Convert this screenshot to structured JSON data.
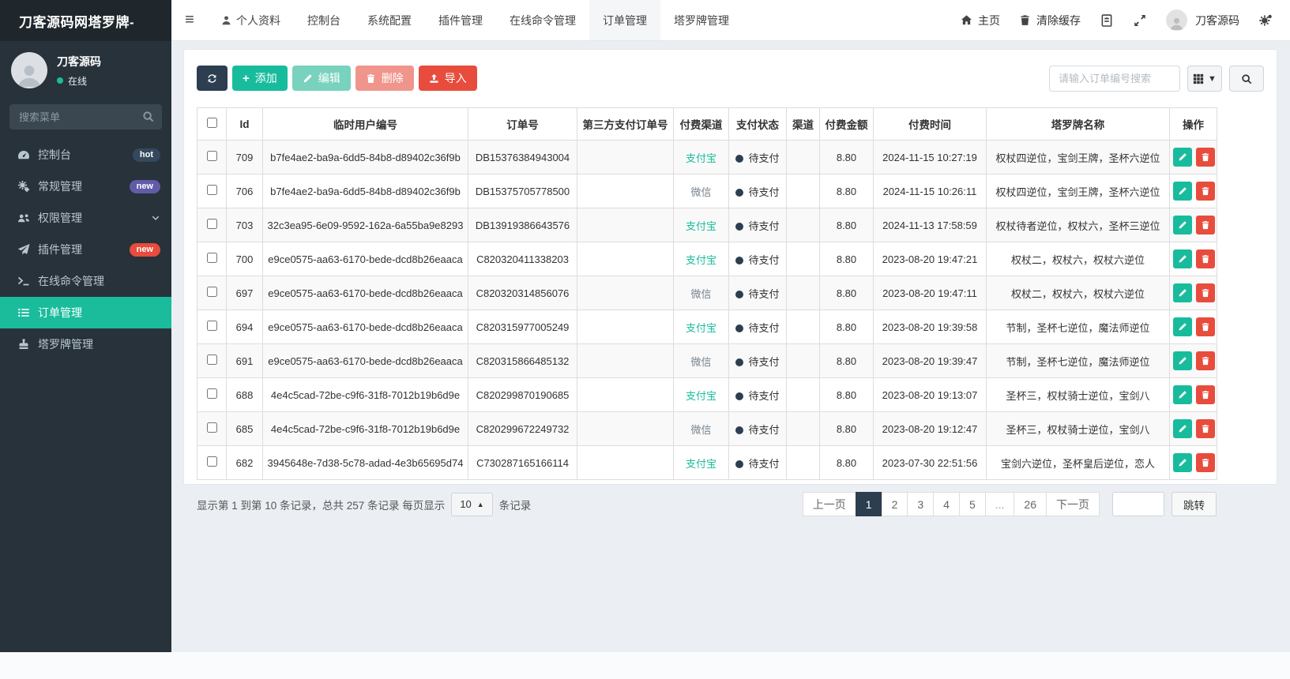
{
  "sidebar": {
    "logo": "刀客源码网塔罗牌-",
    "user": {
      "name": "刀客源码",
      "status": "在线"
    },
    "search_placeholder": "搜索菜单",
    "items": [
      {
        "label": "控制台",
        "icon": "tachometer-icon",
        "badge": {
          "text": "hot",
          "color": "#34495e"
        }
      },
      {
        "label": "常规管理",
        "icon": "gears-icon",
        "badge": {
          "text": "new",
          "color": "#605ca8"
        }
      },
      {
        "label": "权限管理",
        "icon": "users-icon"
      },
      {
        "label": "插件管理",
        "icon": "paper-plane-icon",
        "badge": {
          "text": "new",
          "color": "#e74c3c"
        }
      },
      {
        "label": "在线命令管理",
        "icon": "terminal-icon"
      },
      {
        "label": "订单管理",
        "icon": "list-icon",
        "active": true
      },
      {
        "label": "塔罗牌管理",
        "icon": "stamp-icon"
      }
    ]
  },
  "topnav": {
    "tabs": [
      {
        "label": "个人资料",
        "icon": "user-icon"
      },
      {
        "label": "控制台"
      },
      {
        "label": "系统配置"
      },
      {
        "label": "插件管理"
      },
      {
        "label": "在线命令管理"
      },
      {
        "label": "订单管理",
        "active": true
      },
      {
        "label": "塔罗牌管理"
      }
    ],
    "right": {
      "home": "主页",
      "clear_cache": "清除缓存",
      "username": "刀客源码"
    }
  },
  "toolbar": {
    "add_label": "添加",
    "edit_label": "编辑",
    "delete_label": "删除",
    "import_label": "导入",
    "search_placeholder": "请输入订单编号搜索"
  },
  "table": {
    "columns": [
      "Id",
      "临时用户编号",
      "订单号",
      "第三方支付订单号",
      "付费渠道",
      "支付状态",
      "渠道",
      "付费金额",
      "付费时间",
      "塔罗牌名称",
      "操作"
    ],
    "rows": [
      {
        "id": "709",
        "user_code": "b7fe4ae2-ba9a-6dd5-84b8-d89402c36f9b",
        "order_no": "DB15376384943004",
        "third_no": "",
        "channel": "支付宝",
        "channel_color": "#1abc9c",
        "status": "待支付",
        "qudao": "",
        "amount": "8.80",
        "time": "2024-11-15 10:27:19",
        "tarot": "权杖四逆位，宝剑王牌，圣杯六逆位"
      },
      {
        "id": "706",
        "user_code": "b7fe4ae2-ba9a-6dd5-84b8-d89402c36f9b",
        "order_no": "DB15375705778500",
        "third_no": "",
        "channel": "微信",
        "channel_color": "#76838f",
        "status": "待支付",
        "qudao": "",
        "amount": "8.80",
        "time": "2024-11-15 10:26:11",
        "tarot": "权杖四逆位，宝剑王牌，圣杯六逆位"
      },
      {
        "id": "703",
        "user_code": "32c3ea95-6e09-9592-162a-6a55ba9e8293",
        "order_no": "DB13919386643576",
        "third_no": "",
        "channel": "支付宝",
        "channel_color": "#1abc9c",
        "status": "待支付",
        "qudao": "",
        "amount": "8.80",
        "time": "2024-11-13 17:58:59",
        "tarot": "权杖待者逆位，权杖六，圣杯三逆位"
      },
      {
        "id": "700",
        "user_code": "e9ce0575-aa63-6170-bede-dcd8b26eaaca",
        "order_no": "C820320411338203",
        "third_no": "",
        "channel": "支付宝",
        "channel_color": "#1abc9c",
        "status": "待支付",
        "qudao": "",
        "amount": "8.80",
        "time": "2023-08-20 19:47:21",
        "tarot": "权杖二，权杖六，权杖六逆位"
      },
      {
        "id": "697",
        "user_code": "e9ce0575-aa63-6170-bede-dcd8b26eaaca",
        "order_no": "C820320314856076",
        "third_no": "",
        "channel": "微信",
        "channel_color": "#76838f",
        "status": "待支付",
        "qudao": "",
        "amount": "8.80",
        "time": "2023-08-20 19:47:11",
        "tarot": "权杖二，权杖六，权杖六逆位"
      },
      {
        "id": "694",
        "user_code": "e9ce0575-aa63-6170-bede-dcd8b26eaaca",
        "order_no": "C820315977005249",
        "third_no": "",
        "channel": "支付宝",
        "channel_color": "#1abc9c",
        "status": "待支付",
        "qudao": "",
        "amount": "8.80",
        "time": "2023-08-20 19:39:58",
        "tarot": "节制，圣杯七逆位，魔法师逆位"
      },
      {
        "id": "691",
        "user_code": "e9ce0575-aa63-6170-bede-dcd8b26eaaca",
        "order_no": "C820315866485132",
        "third_no": "",
        "channel": "微信",
        "channel_color": "#76838f",
        "status": "待支付",
        "qudao": "",
        "amount": "8.80",
        "time": "2023-08-20 19:39:47",
        "tarot": "节制，圣杯七逆位，魔法师逆位"
      },
      {
        "id": "688",
        "user_code": "4e4c5cad-72be-c9f6-31f8-7012b19b6d9e",
        "order_no": "C820299870190685",
        "third_no": "",
        "channel": "支付宝",
        "channel_color": "#1abc9c",
        "status": "待支付",
        "qudao": "",
        "amount": "8.80",
        "time": "2023-08-20 19:13:07",
        "tarot": "圣杯三，权杖骑士逆位，宝剑八"
      },
      {
        "id": "685",
        "user_code": "4e4c5cad-72be-c9f6-31f8-7012b19b6d9e",
        "order_no": "C820299672249732",
        "third_no": "",
        "channel": "微信",
        "channel_color": "#76838f",
        "status": "待支付",
        "qudao": "",
        "amount": "8.80",
        "time": "2023-08-20 19:12:47",
        "tarot": "圣杯三，权杖骑士逆位，宝剑八"
      },
      {
        "id": "682",
        "user_code": "3945648e-7d38-5c78-adad-4e3b65695d74",
        "order_no": "C730287165166114",
        "third_no": "",
        "channel": "支付宝",
        "channel_color": "#1abc9c",
        "status": "待支付",
        "qudao": "",
        "amount": "8.80",
        "time": "2023-07-30 22:51:56",
        "tarot": "宝剑六逆位，圣杯皇后逆位，恋人"
      }
    ],
    "status_dot_color": "#2c3e50"
  },
  "footer": {
    "summary_prefix": "显示第 1 到第 10 条记录，总共 257 条记录 每页显示",
    "page_size": "10",
    "summary_suffix": "条记录",
    "pagination": {
      "prev": "上一页",
      "next": "下一页",
      "pages": [
        "1",
        "2",
        "3",
        "4",
        "5",
        "...",
        "26"
      ],
      "active": "1",
      "jump": "跳转"
    }
  },
  "colors": {
    "accent": "#1abc9c",
    "danger": "#e74c3c",
    "dark_navy": "#2c3e50"
  }
}
